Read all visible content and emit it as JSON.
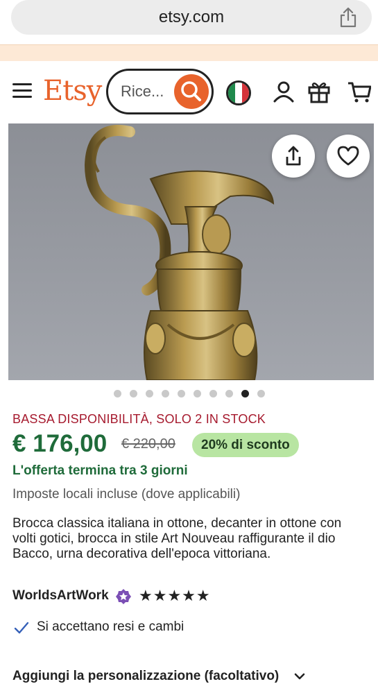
{
  "browser": {
    "url": "etsy.com",
    "share_icon": "share-icon"
  },
  "header": {
    "logo": "Etsy",
    "search_placeholder": "Ricerca su Etsy",
    "search_visible_text": "Rice...",
    "colors": {
      "brand": "#e8632c"
    },
    "icons": [
      "menu-icon",
      "search-icon",
      "italy-flag-icon",
      "account-icon",
      "gift-icon",
      "cart-icon"
    ]
  },
  "product": {
    "image": {
      "share_icon": "share-icon",
      "favorite_icon": "heart-icon",
      "total_images": 10,
      "active_image": 9
    },
    "stock": "BASSA DISPONIBILITÀ, SOLO 2 IN STOCK",
    "price": "€ 176,00",
    "old_price": "€ 220,00",
    "discount": "20% di sconto",
    "offer_end": "L'offerta termina tra 3 giorni",
    "taxes": "Imposte locali incluse (dove applicabili)",
    "description": "Brocca classica italiana in ottone, decanter in ottone con volti gotici, brocca in stile Art Nouveau raffigurante il dio Bacco, urna decorativa dell'epoca vittoriana.",
    "shop": {
      "name": "WorldsArtWork",
      "rating": 5,
      "stars": "★★★★★"
    },
    "returns": "Si accettano resi e cambi",
    "personalization": "Aggiungi la personalizzazione (facoltativo)",
    "colors": {
      "price": "#1f6b3a",
      "stock": "#a61a2e",
      "discount_bg": "#b8e5a2"
    }
  }
}
